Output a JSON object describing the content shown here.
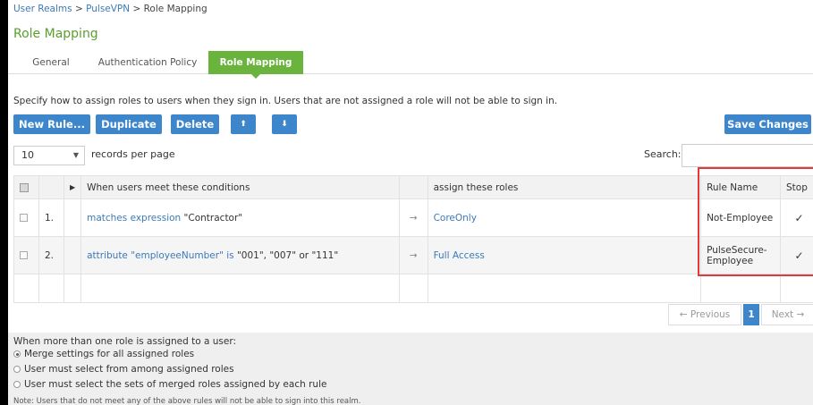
{
  "breadcrumb": {
    "realms": "User Realms",
    "sep1": " > ",
    "realm": "PulseVPN",
    "sep2": " > ",
    "current": "Role Mapping"
  },
  "page_title": "Role Mapping",
  "tabs": [
    {
      "label": "General"
    },
    {
      "label": "Authentication Policy"
    },
    {
      "label": "Role Mapping",
      "active": true
    }
  ],
  "description": "Specify how to assign roles to users when they sign in. Users that are not assigned a role will not be able to sign in.",
  "toolbar": {
    "new_rule": "New Rule...",
    "duplicate": "Duplicate",
    "delete": "Delete",
    "move_up": "⬆",
    "move_down": "⬇",
    "save_changes": "Save Changes"
  },
  "records": {
    "value": "10",
    "caret": "▼",
    "label": "records per page"
  },
  "search": {
    "label": "Search:",
    "value": ""
  },
  "table": {
    "headers": {
      "sort": "▶",
      "conditions": "When users meet these conditions",
      "roles": "assign these roles",
      "rule_name": "Rule Name",
      "stop": "Stop"
    },
    "rows": [
      {
        "num": "1.",
        "cond_link": "matches expression",
        "cond_text": " \"Contractor\"",
        "arrow": "→",
        "role": "CoreOnly",
        "rule_name": "Not-Employee",
        "stop": "✓"
      },
      {
        "num": "2.",
        "cond_link": "attribute \"employeeNumber\" is",
        "cond_text": " \"001\", \"007\" or \"111\"",
        "arrow": "→",
        "role": "Full Access",
        "rule_name": "PulseSecure-Employee",
        "stop": "✓"
      }
    ]
  },
  "pagination": {
    "previous": "← Previous",
    "current": "1",
    "next": "Next →"
  },
  "options": {
    "title": "When more than one role is assigned to a user:",
    "items": [
      {
        "label": "Merge settings for all assigned roles",
        "selected": true
      },
      {
        "label": "User must select from among assigned roles",
        "selected": false
      },
      {
        "label": "User must select the sets of merged roles assigned by each rule",
        "selected": false
      }
    ],
    "note": "Note: Users that do not meet any of the above rules will not be able to sign into this realm."
  },
  "colors": {
    "accent": "#3d86cc",
    "tab_active": "#6ab43e",
    "title": "#5a9e2f",
    "highlight": "#e03a3a"
  }
}
